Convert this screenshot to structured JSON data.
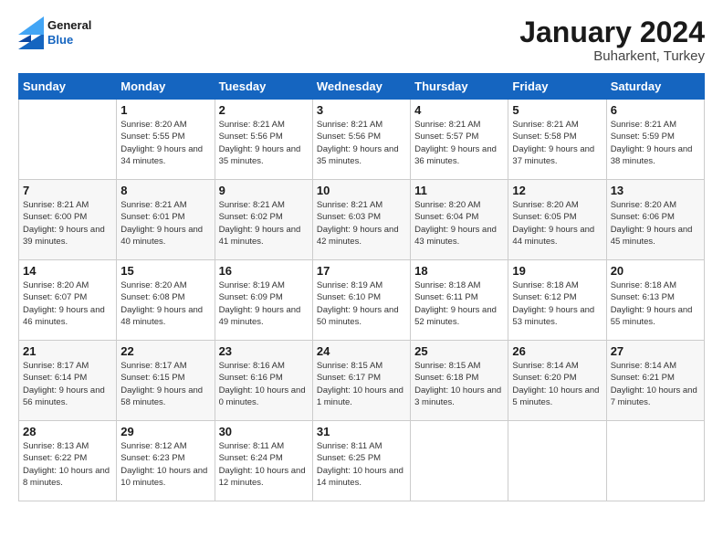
{
  "logo": {
    "general": "General",
    "blue": "Blue"
  },
  "title": "January 2024",
  "subtitle": "Buharkent, Turkey",
  "days_of_week": [
    "Sunday",
    "Monday",
    "Tuesday",
    "Wednesday",
    "Thursday",
    "Friday",
    "Saturday"
  ],
  "weeks": [
    [
      {
        "day": "",
        "sunrise": "",
        "sunset": "",
        "daylight": ""
      },
      {
        "day": "1",
        "sunrise": "Sunrise: 8:20 AM",
        "sunset": "Sunset: 5:55 PM",
        "daylight": "Daylight: 9 hours and 34 minutes."
      },
      {
        "day": "2",
        "sunrise": "Sunrise: 8:21 AM",
        "sunset": "Sunset: 5:56 PM",
        "daylight": "Daylight: 9 hours and 35 minutes."
      },
      {
        "day": "3",
        "sunrise": "Sunrise: 8:21 AM",
        "sunset": "Sunset: 5:56 PM",
        "daylight": "Daylight: 9 hours and 35 minutes."
      },
      {
        "day": "4",
        "sunrise": "Sunrise: 8:21 AM",
        "sunset": "Sunset: 5:57 PM",
        "daylight": "Daylight: 9 hours and 36 minutes."
      },
      {
        "day": "5",
        "sunrise": "Sunrise: 8:21 AM",
        "sunset": "Sunset: 5:58 PM",
        "daylight": "Daylight: 9 hours and 37 minutes."
      },
      {
        "day": "6",
        "sunrise": "Sunrise: 8:21 AM",
        "sunset": "Sunset: 5:59 PM",
        "daylight": "Daylight: 9 hours and 38 minutes."
      }
    ],
    [
      {
        "day": "7",
        "sunrise": "Sunrise: 8:21 AM",
        "sunset": "Sunset: 6:00 PM",
        "daylight": "Daylight: 9 hours and 39 minutes."
      },
      {
        "day": "8",
        "sunrise": "Sunrise: 8:21 AM",
        "sunset": "Sunset: 6:01 PM",
        "daylight": "Daylight: 9 hours and 40 minutes."
      },
      {
        "day": "9",
        "sunrise": "Sunrise: 8:21 AM",
        "sunset": "Sunset: 6:02 PM",
        "daylight": "Daylight: 9 hours and 41 minutes."
      },
      {
        "day": "10",
        "sunrise": "Sunrise: 8:21 AM",
        "sunset": "Sunset: 6:03 PM",
        "daylight": "Daylight: 9 hours and 42 minutes."
      },
      {
        "day": "11",
        "sunrise": "Sunrise: 8:20 AM",
        "sunset": "Sunset: 6:04 PM",
        "daylight": "Daylight: 9 hours and 43 minutes."
      },
      {
        "day": "12",
        "sunrise": "Sunrise: 8:20 AM",
        "sunset": "Sunset: 6:05 PM",
        "daylight": "Daylight: 9 hours and 44 minutes."
      },
      {
        "day": "13",
        "sunrise": "Sunrise: 8:20 AM",
        "sunset": "Sunset: 6:06 PM",
        "daylight": "Daylight: 9 hours and 45 minutes."
      }
    ],
    [
      {
        "day": "14",
        "sunrise": "Sunrise: 8:20 AM",
        "sunset": "Sunset: 6:07 PM",
        "daylight": "Daylight: 9 hours and 46 minutes."
      },
      {
        "day": "15",
        "sunrise": "Sunrise: 8:20 AM",
        "sunset": "Sunset: 6:08 PM",
        "daylight": "Daylight: 9 hours and 48 minutes."
      },
      {
        "day": "16",
        "sunrise": "Sunrise: 8:19 AM",
        "sunset": "Sunset: 6:09 PM",
        "daylight": "Daylight: 9 hours and 49 minutes."
      },
      {
        "day": "17",
        "sunrise": "Sunrise: 8:19 AM",
        "sunset": "Sunset: 6:10 PM",
        "daylight": "Daylight: 9 hours and 50 minutes."
      },
      {
        "day": "18",
        "sunrise": "Sunrise: 8:18 AM",
        "sunset": "Sunset: 6:11 PM",
        "daylight": "Daylight: 9 hours and 52 minutes."
      },
      {
        "day": "19",
        "sunrise": "Sunrise: 8:18 AM",
        "sunset": "Sunset: 6:12 PM",
        "daylight": "Daylight: 9 hours and 53 minutes."
      },
      {
        "day": "20",
        "sunrise": "Sunrise: 8:18 AM",
        "sunset": "Sunset: 6:13 PM",
        "daylight": "Daylight: 9 hours and 55 minutes."
      }
    ],
    [
      {
        "day": "21",
        "sunrise": "Sunrise: 8:17 AM",
        "sunset": "Sunset: 6:14 PM",
        "daylight": "Daylight: 9 hours and 56 minutes."
      },
      {
        "day": "22",
        "sunrise": "Sunrise: 8:17 AM",
        "sunset": "Sunset: 6:15 PM",
        "daylight": "Daylight: 9 hours and 58 minutes."
      },
      {
        "day": "23",
        "sunrise": "Sunrise: 8:16 AM",
        "sunset": "Sunset: 6:16 PM",
        "daylight": "Daylight: 10 hours and 0 minutes."
      },
      {
        "day": "24",
        "sunrise": "Sunrise: 8:15 AM",
        "sunset": "Sunset: 6:17 PM",
        "daylight": "Daylight: 10 hours and 1 minute."
      },
      {
        "day": "25",
        "sunrise": "Sunrise: 8:15 AM",
        "sunset": "Sunset: 6:18 PM",
        "daylight": "Daylight: 10 hours and 3 minutes."
      },
      {
        "day": "26",
        "sunrise": "Sunrise: 8:14 AM",
        "sunset": "Sunset: 6:20 PM",
        "daylight": "Daylight: 10 hours and 5 minutes."
      },
      {
        "day": "27",
        "sunrise": "Sunrise: 8:14 AM",
        "sunset": "Sunset: 6:21 PM",
        "daylight": "Daylight: 10 hours and 7 minutes."
      }
    ],
    [
      {
        "day": "28",
        "sunrise": "Sunrise: 8:13 AM",
        "sunset": "Sunset: 6:22 PM",
        "daylight": "Daylight: 10 hours and 8 minutes."
      },
      {
        "day": "29",
        "sunrise": "Sunrise: 8:12 AM",
        "sunset": "Sunset: 6:23 PM",
        "daylight": "Daylight: 10 hours and 10 minutes."
      },
      {
        "day": "30",
        "sunrise": "Sunrise: 8:11 AM",
        "sunset": "Sunset: 6:24 PM",
        "daylight": "Daylight: 10 hours and 12 minutes."
      },
      {
        "day": "31",
        "sunrise": "Sunrise: 8:11 AM",
        "sunset": "Sunset: 6:25 PM",
        "daylight": "Daylight: 10 hours and 14 minutes."
      },
      {
        "day": "",
        "sunrise": "",
        "sunset": "",
        "daylight": ""
      },
      {
        "day": "",
        "sunrise": "",
        "sunset": "",
        "daylight": ""
      },
      {
        "day": "",
        "sunrise": "",
        "sunset": "",
        "daylight": ""
      }
    ]
  ]
}
